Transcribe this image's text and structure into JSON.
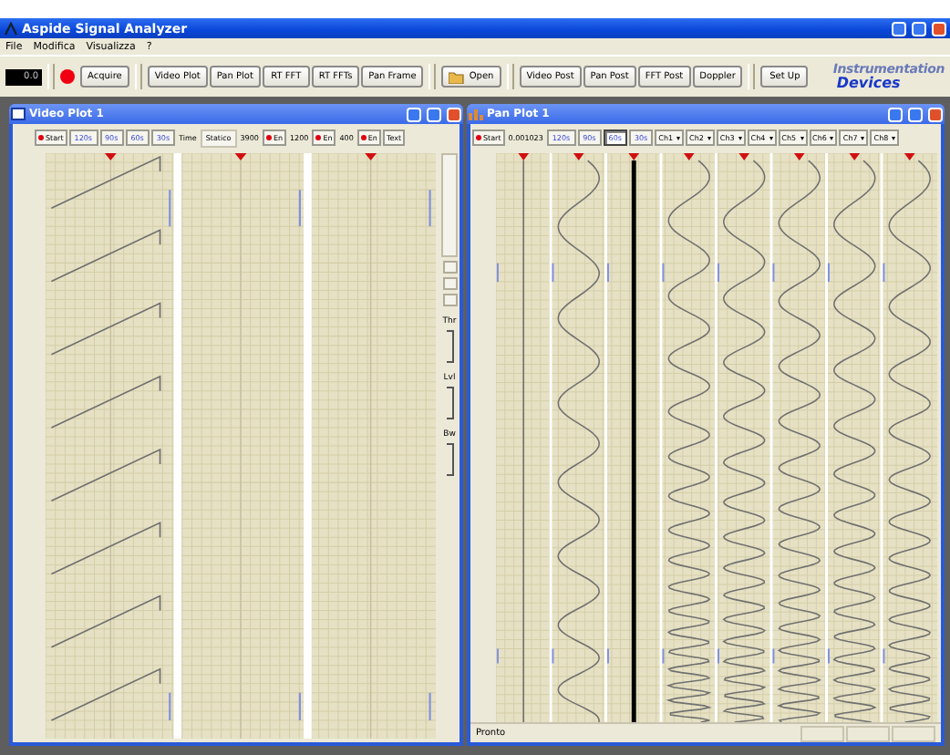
{
  "window": {
    "title": "Aspide Signal Analyzer"
  },
  "menu": [
    "File",
    "Modifica",
    "Visualizza",
    "?"
  ],
  "toolbar": {
    "display": "0.0",
    "groups": [
      {
        "buttons": [
          {
            "label": "Acquire",
            "kind": "record"
          }
        ]
      },
      {
        "buttons": [
          {
            "label": "Video Plot"
          },
          {
            "label": "Pan Plot"
          },
          {
            "label": "RT FFT"
          },
          {
            "label": "RT FFTs"
          },
          {
            "label": "Pan Frame"
          }
        ]
      },
      {
        "buttons": [
          {
            "label": "Open",
            "kind": "folder"
          }
        ]
      },
      {
        "buttons": [
          {
            "label": "Video Post"
          },
          {
            "label": "Pan Post"
          },
          {
            "label": "FFT Post"
          },
          {
            "label": "Doppler"
          }
        ]
      },
      {
        "buttons": [
          {
            "label": "Set Up"
          }
        ]
      }
    ]
  },
  "logo": {
    "line_1": "Instrumentation",
    "line_2": "Devices"
  },
  "video_plot": {
    "title": "Video Plot 1",
    "controls": [
      {
        "kind": "button",
        "label": "Start",
        "dot": true
      },
      {
        "kind": "time",
        "label": "120s",
        "selected": false
      },
      {
        "kind": "time",
        "label": "90s",
        "selected": false
      },
      {
        "kind": "time",
        "label": "60s",
        "selected": false
      },
      {
        "kind": "time",
        "label": "30s",
        "selected": false
      },
      {
        "kind": "label",
        "label": "Time"
      },
      {
        "kind": "field",
        "value": "Statico"
      },
      {
        "kind": "label",
        "label": "3900"
      },
      {
        "kind": "button",
        "label": "En",
        "dot": true
      },
      {
        "kind": "label",
        "label": "1200"
      },
      {
        "kind": "button",
        "label": "En",
        "dot": true
      },
      {
        "kind": "label",
        "label": "400"
      },
      {
        "kind": "button",
        "label": "En",
        "dot": true
      },
      {
        "kind": "button",
        "label": "Text",
        "dot": false
      }
    ],
    "side_labels": [
      "Thr",
      "Lvl",
      "Bw"
    ]
  },
  "pan_plot": {
    "title": "Pan Plot 1",
    "controls": [
      {
        "kind": "button",
        "label": "Start",
        "dot": true
      },
      {
        "kind": "label",
        "label": "0.001023"
      },
      {
        "kind": "time",
        "label": "120s",
        "selected": false
      },
      {
        "kind": "time",
        "label": "90s",
        "selected": false
      },
      {
        "kind": "time",
        "label": "60s",
        "selected": true
      },
      {
        "kind": "time",
        "label": "30s",
        "selected": false
      },
      {
        "kind": "dropdown",
        "label": "Ch1"
      },
      {
        "kind": "dropdown",
        "label": "Ch2"
      },
      {
        "kind": "dropdown",
        "label": "Ch3"
      },
      {
        "kind": "dropdown",
        "label": "Ch4"
      },
      {
        "kind": "dropdown",
        "label": "Ch5"
      },
      {
        "kind": "dropdown",
        "label": "Ch6"
      },
      {
        "kind": "dropdown",
        "label": "Ch7"
      },
      {
        "kind": "dropdown",
        "label": "Ch8"
      }
    ],
    "status": "Pronto"
  }
}
